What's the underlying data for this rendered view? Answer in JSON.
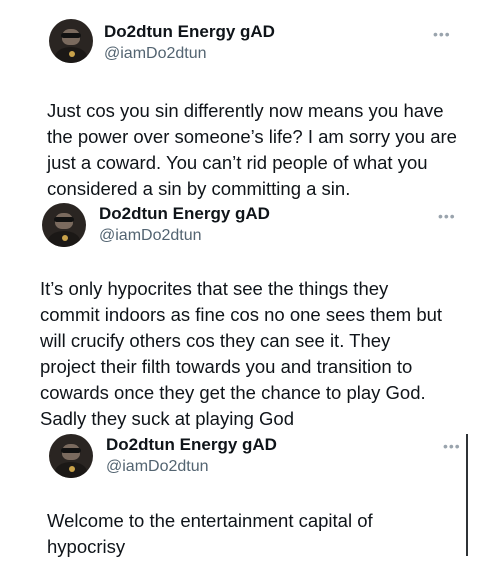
{
  "tweets": [
    {
      "author": "Do2dtun Energy gAD",
      "handle": "@iamDo2dtun",
      "more_icon": "ellipsis-icon",
      "lines": [
        "Just cos you sin differently now means you have",
        "the power over someone’s life? I am sorry you are",
        "just a coward. You can’t rid people of what you",
        "considered a sin by committing a sin."
      ]
    },
    {
      "author": "Do2dtun Energy gAD",
      "handle": "@iamDo2dtun",
      "more_icon": "ellipsis-icon",
      "lines": [
        "It’s only hypocrites that see the things they",
        "commit indoors as fine cos no one sees them but",
        "will crucify others cos they can see it. They",
        "project their filth towards you and transition to",
        "cowards once they get the chance to play God.",
        "Sadly they suck at playing God"
      ]
    },
    {
      "author": "Do2dtun Energy gAD",
      "handle": "@iamDo2dtun",
      "more_icon": "ellipsis-icon",
      "lines": [
        "Welcome to the entertainment capital of",
        "hypocrisy"
      ]
    }
  ]
}
